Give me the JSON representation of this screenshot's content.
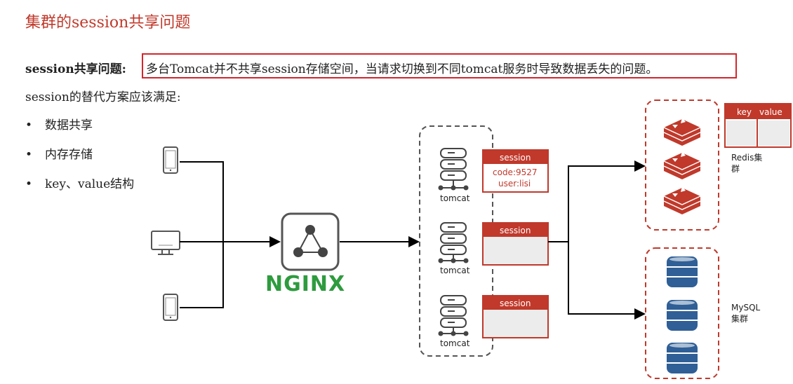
{
  "title": "集群的session共享问题",
  "problem": {
    "label": "session共享问题:",
    "text": "多台Tomcat并不共享session存储空间，当请求切换到不同tomcat服务时导致数据丢失的问题。"
  },
  "requirements": {
    "intro": "session的替代方案应该满足:",
    "items": [
      "数据共享",
      "内存存储",
      "key、value结构"
    ]
  },
  "diagram": {
    "nginx_label": "NGINX",
    "tomcat_label": "tomcat",
    "session_header": "session",
    "session_values": [
      "code:9527",
      "user:lisi"
    ],
    "kv_table": {
      "key": "key",
      "value": "value"
    },
    "redis_label_line1": "Redis集",
    "redis_label_line2": "群",
    "mysql_label_line1": "MySQL",
    "mysql_label_line2": "集群",
    "accent_red": "#d3262c",
    "nginx_green": "#2e9b3e",
    "db_blue": "#2f5f96"
  }
}
